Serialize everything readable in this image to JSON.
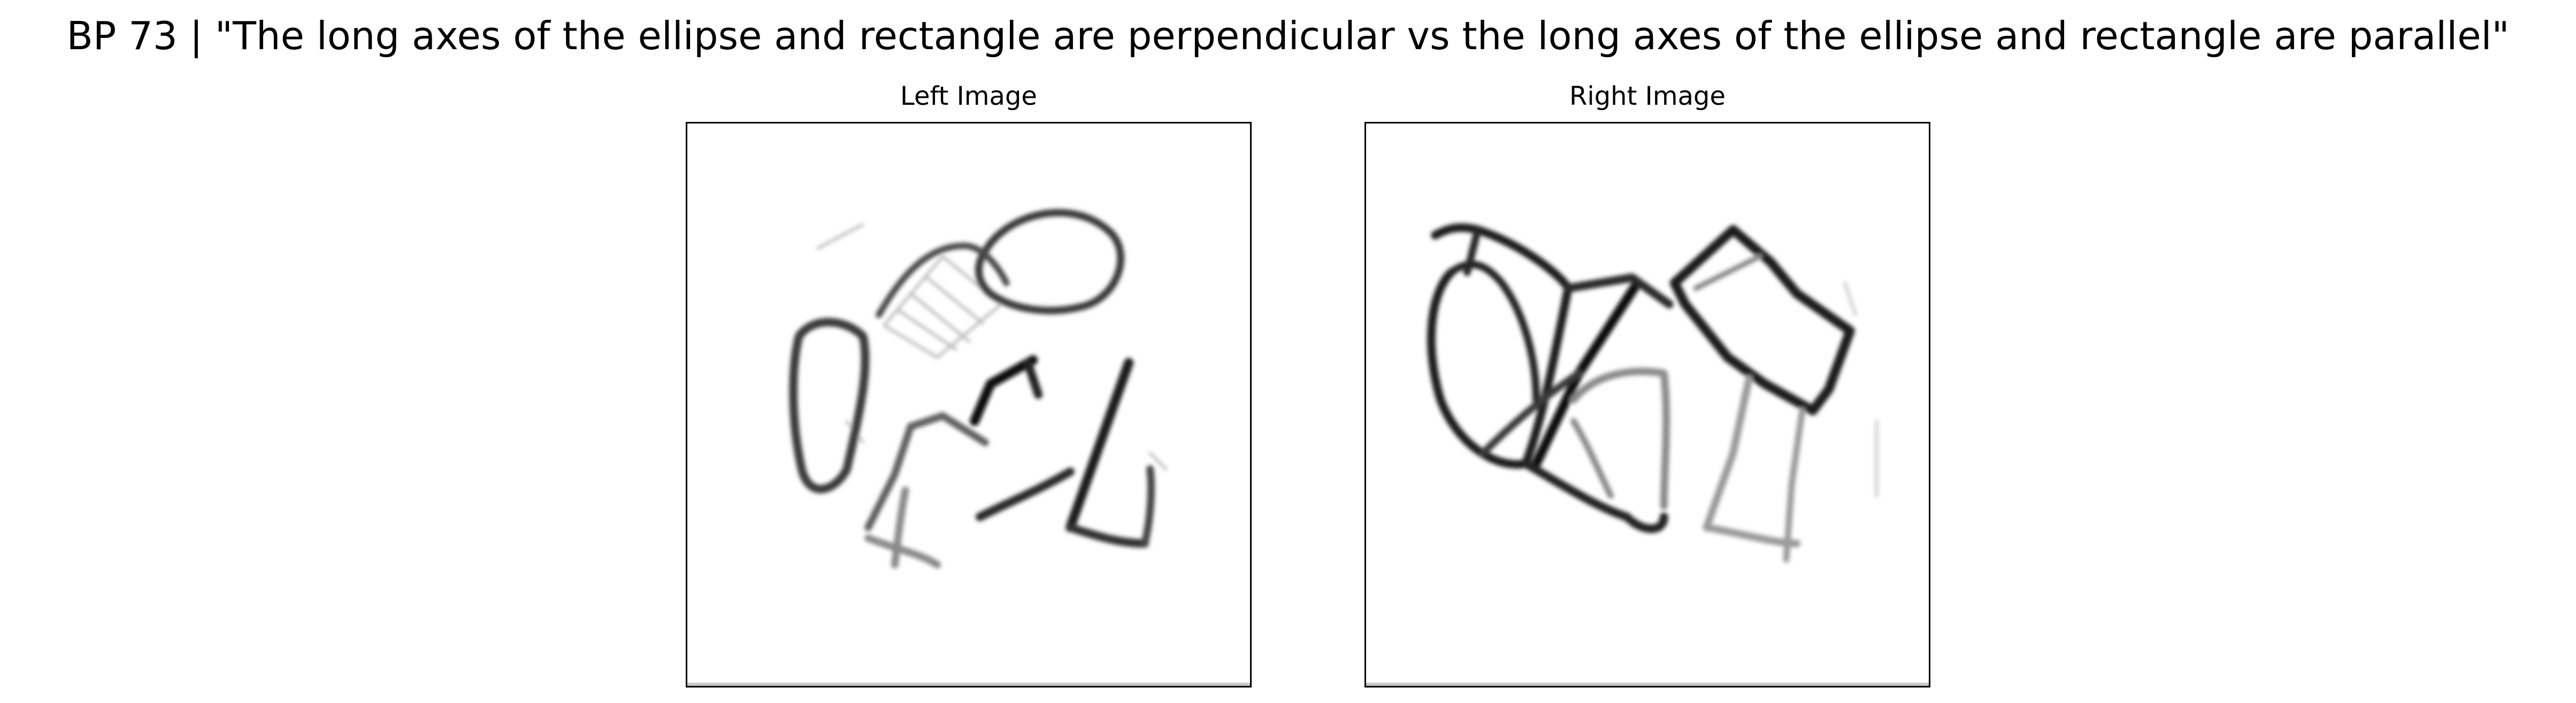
{
  "figure": {
    "title": "BP 73 | \"The long axes of the ellipse and rectangle are perpendicular vs the long axes of the ellipse and rectangle are parallel\""
  },
  "panels": [
    {
      "title": "Left Image"
    },
    {
      "title": "Right Image"
    }
  ],
  "colors": {
    "background": "#ffffff",
    "frame": "#000000",
    "stroke": "#1a1a1a"
  }
}
